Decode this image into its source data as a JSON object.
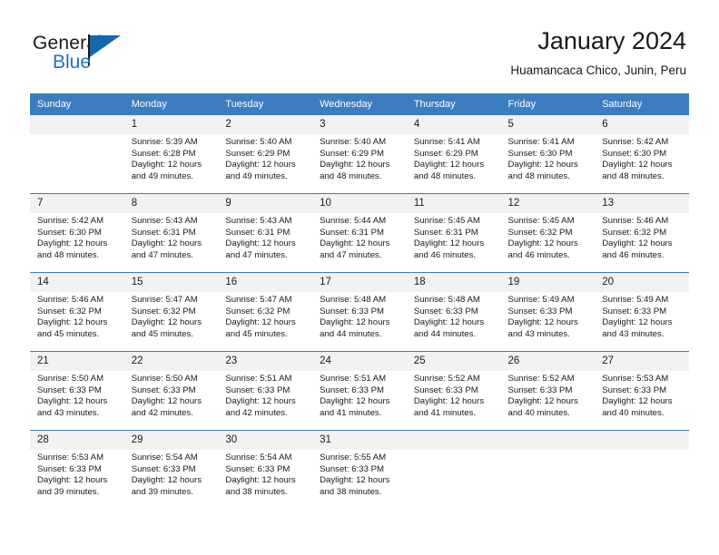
{
  "brand": {
    "name_part1": "General",
    "name_part2": "Blue",
    "flag_icon": "blue-flag-icon",
    "accent_color": "#1668ad"
  },
  "header": {
    "title": "January 2024",
    "subtitle": "Huamancaca Chico, Junin, Peru"
  },
  "theme": {
    "header_row_bg": "#3b7dc0",
    "daynum_bg": "#f2f2f2",
    "row_divider": "#3b7dc0",
    "text": "#1a1a1a"
  },
  "weekdays": [
    "Sunday",
    "Monday",
    "Tuesday",
    "Wednesday",
    "Thursday",
    "Friday",
    "Saturday"
  ],
  "weeks": [
    [
      {
        "day": "",
        "sunrise": "",
        "sunset": "",
        "daylight_line1": "",
        "daylight_line2": ""
      },
      {
        "day": "1",
        "sunrise": "Sunrise: 5:39 AM",
        "sunset": "Sunset: 6:28 PM",
        "daylight_line1": "Daylight: 12 hours",
        "daylight_line2": "and 49 minutes."
      },
      {
        "day": "2",
        "sunrise": "Sunrise: 5:40 AM",
        "sunset": "Sunset: 6:29 PM",
        "daylight_line1": "Daylight: 12 hours",
        "daylight_line2": "and 49 minutes."
      },
      {
        "day": "3",
        "sunrise": "Sunrise: 5:40 AM",
        "sunset": "Sunset: 6:29 PM",
        "daylight_line1": "Daylight: 12 hours",
        "daylight_line2": "and 48 minutes."
      },
      {
        "day": "4",
        "sunrise": "Sunrise: 5:41 AM",
        "sunset": "Sunset: 6:29 PM",
        "daylight_line1": "Daylight: 12 hours",
        "daylight_line2": "and 48 minutes."
      },
      {
        "day": "5",
        "sunrise": "Sunrise: 5:41 AM",
        "sunset": "Sunset: 6:30 PM",
        "daylight_line1": "Daylight: 12 hours",
        "daylight_line2": "and 48 minutes."
      },
      {
        "day": "6",
        "sunrise": "Sunrise: 5:42 AM",
        "sunset": "Sunset: 6:30 PM",
        "daylight_line1": "Daylight: 12 hours",
        "daylight_line2": "and 48 minutes."
      }
    ],
    [
      {
        "day": "7",
        "sunrise": "Sunrise: 5:42 AM",
        "sunset": "Sunset: 6:30 PM",
        "daylight_line1": "Daylight: 12 hours",
        "daylight_line2": "and 48 minutes."
      },
      {
        "day": "8",
        "sunrise": "Sunrise: 5:43 AM",
        "sunset": "Sunset: 6:31 PM",
        "daylight_line1": "Daylight: 12 hours",
        "daylight_line2": "and 47 minutes."
      },
      {
        "day": "9",
        "sunrise": "Sunrise: 5:43 AM",
        "sunset": "Sunset: 6:31 PM",
        "daylight_line1": "Daylight: 12 hours",
        "daylight_line2": "and 47 minutes."
      },
      {
        "day": "10",
        "sunrise": "Sunrise: 5:44 AM",
        "sunset": "Sunset: 6:31 PM",
        "daylight_line1": "Daylight: 12 hours",
        "daylight_line2": "and 47 minutes."
      },
      {
        "day": "11",
        "sunrise": "Sunrise: 5:45 AM",
        "sunset": "Sunset: 6:31 PM",
        "daylight_line1": "Daylight: 12 hours",
        "daylight_line2": "and 46 minutes."
      },
      {
        "day": "12",
        "sunrise": "Sunrise: 5:45 AM",
        "sunset": "Sunset: 6:32 PM",
        "daylight_line1": "Daylight: 12 hours",
        "daylight_line2": "and 46 minutes."
      },
      {
        "day": "13",
        "sunrise": "Sunrise: 5:46 AM",
        "sunset": "Sunset: 6:32 PM",
        "daylight_line1": "Daylight: 12 hours",
        "daylight_line2": "and 46 minutes."
      }
    ],
    [
      {
        "day": "14",
        "sunrise": "Sunrise: 5:46 AM",
        "sunset": "Sunset: 6:32 PM",
        "daylight_line1": "Daylight: 12 hours",
        "daylight_line2": "and 45 minutes."
      },
      {
        "day": "15",
        "sunrise": "Sunrise: 5:47 AM",
        "sunset": "Sunset: 6:32 PM",
        "daylight_line1": "Daylight: 12 hours",
        "daylight_line2": "and 45 minutes."
      },
      {
        "day": "16",
        "sunrise": "Sunrise: 5:47 AM",
        "sunset": "Sunset: 6:32 PM",
        "daylight_line1": "Daylight: 12 hours",
        "daylight_line2": "and 45 minutes."
      },
      {
        "day": "17",
        "sunrise": "Sunrise: 5:48 AM",
        "sunset": "Sunset: 6:33 PM",
        "daylight_line1": "Daylight: 12 hours",
        "daylight_line2": "and 44 minutes."
      },
      {
        "day": "18",
        "sunrise": "Sunrise: 5:48 AM",
        "sunset": "Sunset: 6:33 PM",
        "daylight_line1": "Daylight: 12 hours",
        "daylight_line2": "and 44 minutes."
      },
      {
        "day": "19",
        "sunrise": "Sunrise: 5:49 AM",
        "sunset": "Sunset: 6:33 PM",
        "daylight_line1": "Daylight: 12 hours",
        "daylight_line2": "and 43 minutes."
      },
      {
        "day": "20",
        "sunrise": "Sunrise: 5:49 AM",
        "sunset": "Sunset: 6:33 PM",
        "daylight_line1": "Daylight: 12 hours",
        "daylight_line2": "and 43 minutes."
      }
    ],
    [
      {
        "day": "21",
        "sunrise": "Sunrise: 5:50 AM",
        "sunset": "Sunset: 6:33 PM",
        "daylight_line1": "Daylight: 12 hours",
        "daylight_line2": "and 43 minutes."
      },
      {
        "day": "22",
        "sunrise": "Sunrise: 5:50 AM",
        "sunset": "Sunset: 6:33 PM",
        "daylight_line1": "Daylight: 12 hours",
        "daylight_line2": "and 42 minutes."
      },
      {
        "day": "23",
        "sunrise": "Sunrise: 5:51 AM",
        "sunset": "Sunset: 6:33 PM",
        "daylight_line1": "Daylight: 12 hours",
        "daylight_line2": "and 42 minutes."
      },
      {
        "day": "24",
        "sunrise": "Sunrise: 5:51 AM",
        "sunset": "Sunset: 6:33 PM",
        "daylight_line1": "Daylight: 12 hours",
        "daylight_line2": "and 41 minutes."
      },
      {
        "day": "25",
        "sunrise": "Sunrise: 5:52 AM",
        "sunset": "Sunset: 6:33 PM",
        "daylight_line1": "Daylight: 12 hours",
        "daylight_line2": "and 41 minutes."
      },
      {
        "day": "26",
        "sunrise": "Sunrise: 5:52 AM",
        "sunset": "Sunset: 6:33 PM",
        "daylight_line1": "Daylight: 12 hours",
        "daylight_line2": "and 40 minutes."
      },
      {
        "day": "27",
        "sunrise": "Sunrise: 5:53 AM",
        "sunset": "Sunset: 6:33 PM",
        "daylight_line1": "Daylight: 12 hours",
        "daylight_line2": "and 40 minutes."
      }
    ],
    [
      {
        "day": "28",
        "sunrise": "Sunrise: 5:53 AM",
        "sunset": "Sunset: 6:33 PM",
        "daylight_line1": "Daylight: 12 hours",
        "daylight_line2": "and 39 minutes."
      },
      {
        "day": "29",
        "sunrise": "Sunrise: 5:54 AM",
        "sunset": "Sunset: 6:33 PM",
        "daylight_line1": "Daylight: 12 hours",
        "daylight_line2": "and 39 minutes."
      },
      {
        "day": "30",
        "sunrise": "Sunrise: 5:54 AM",
        "sunset": "Sunset: 6:33 PM",
        "daylight_line1": "Daylight: 12 hours",
        "daylight_line2": "and 38 minutes."
      },
      {
        "day": "31",
        "sunrise": "Sunrise: 5:55 AM",
        "sunset": "Sunset: 6:33 PM",
        "daylight_line1": "Daylight: 12 hours",
        "daylight_line2": "and 38 minutes."
      },
      {
        "day": "",
        "sunrise": "",
        "sunset": "",
        "daylight_line1": "",
        "daylight_line2": ""
      },
      {
        "day": "",
        "sunrise": "",
        "sunset": "",
        "daylight_line1": "",
        "daylight_line2": ""
      },
      {
        "day": "",
        "sunrise": "",
        "sunset": "",
        "daylight_line1": "",
        "daylight_line2": ""
      }
    ]
  ]
}
